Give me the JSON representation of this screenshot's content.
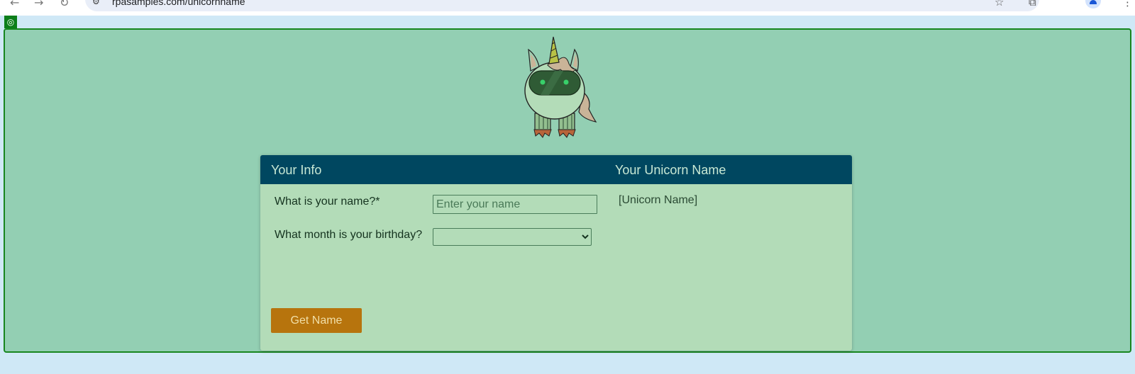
{
  "browser": {
    "url": "rpasamples.com/unicornname"
  },
  "card": {
    "info_header": "Your Info",
    "unicorn_header": "Your Unicorn Name",
    "name_label": "What is your name?*",
    "name_placeholder": "Enter your name",
    "name_value": "",
    "birthday_label": "What month is your birthday?",
    "birthday_selected": "",
    "unicorn_name": "[Unicorn Name]",
    "button_label": "Get Name"
  },
  "colors": {
    "background": "#cfe8f6",
    "stage": "#93cfb3",
    "stage_border": "#17861f",
    "card": "#b3dcb8",
    "header": "#004760",
    "button": "#b7740d"
  }
}
